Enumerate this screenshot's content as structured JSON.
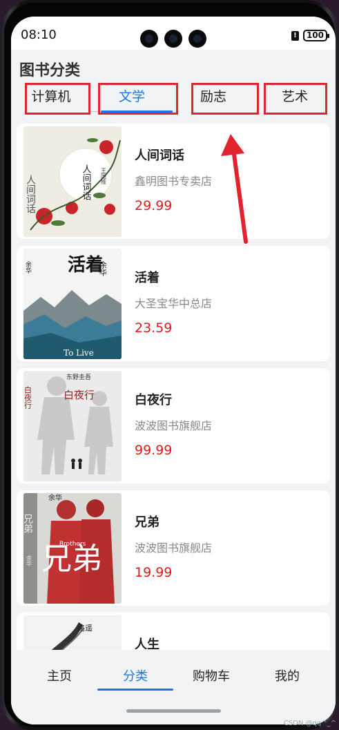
{
  "status": {
    "time": "08:10",
    "sim": "!",
    "battery": "100"
  },
  "page": {
    "title": "图书分类"
  },
  "tabs": [
    {
      "label": "计算机",
      "active": false
    },
    {
      "label": "文学",
      "active": true
    },
    {
      "label": "励志",
      "active": false
    },
    {
      "label": "艺术",
      "active": false
    }
  ],
  "books": [
    {
      "title": "人间词话",
      "shop": "鑫明图书专卖店",
      "price": "29.99",
      "cover_text": "人间词话",
      "cover_author": "王国维"
    },
    {
      "title": "活着",
      "shop": "大圣宝华中总店",
      "price": "23.59",
      "cover_text": "活着",
      "cover_author": "余华",
      "cover_sub": "To Live"
    },
    {
      "title": "白夜行",
      "shop": "波波图书旗舰店",
      "price": "99.99",
      "cover_text": "白夜行",
      "cover_author": "东野圭吾"
    },
    {
      "title": "兄弟",
      "shop": "波波图书旗舰店",
      "price": "19.99",
      "cover_text": "兄弟",
      "cover_author": "余华",
      "cover_sub": "Brothers"
    },
    {
      "title": "人生",
      "shop": "",
      "price": "",
      "cover_text": "人生",
      "cover_author": "路遥"
    }
  ],
  "bottom_nav": [
    {
      "label": "主页",
      "active": false
    },
    {
      "label": "分类",
      "active": true
    },
    {
      "label": "购物车",
      "active": false
    },
    {
      "label": "我的",
      "active": false
    }
  ],
  "watermark": "CSDN @qq^_^",
  "colors": {
    "accent": "#1677e5",
    "price": "#e01a1a",
    "annotation_red": "#e0242e",
    "background": "#f1f3f5"
  }
}
